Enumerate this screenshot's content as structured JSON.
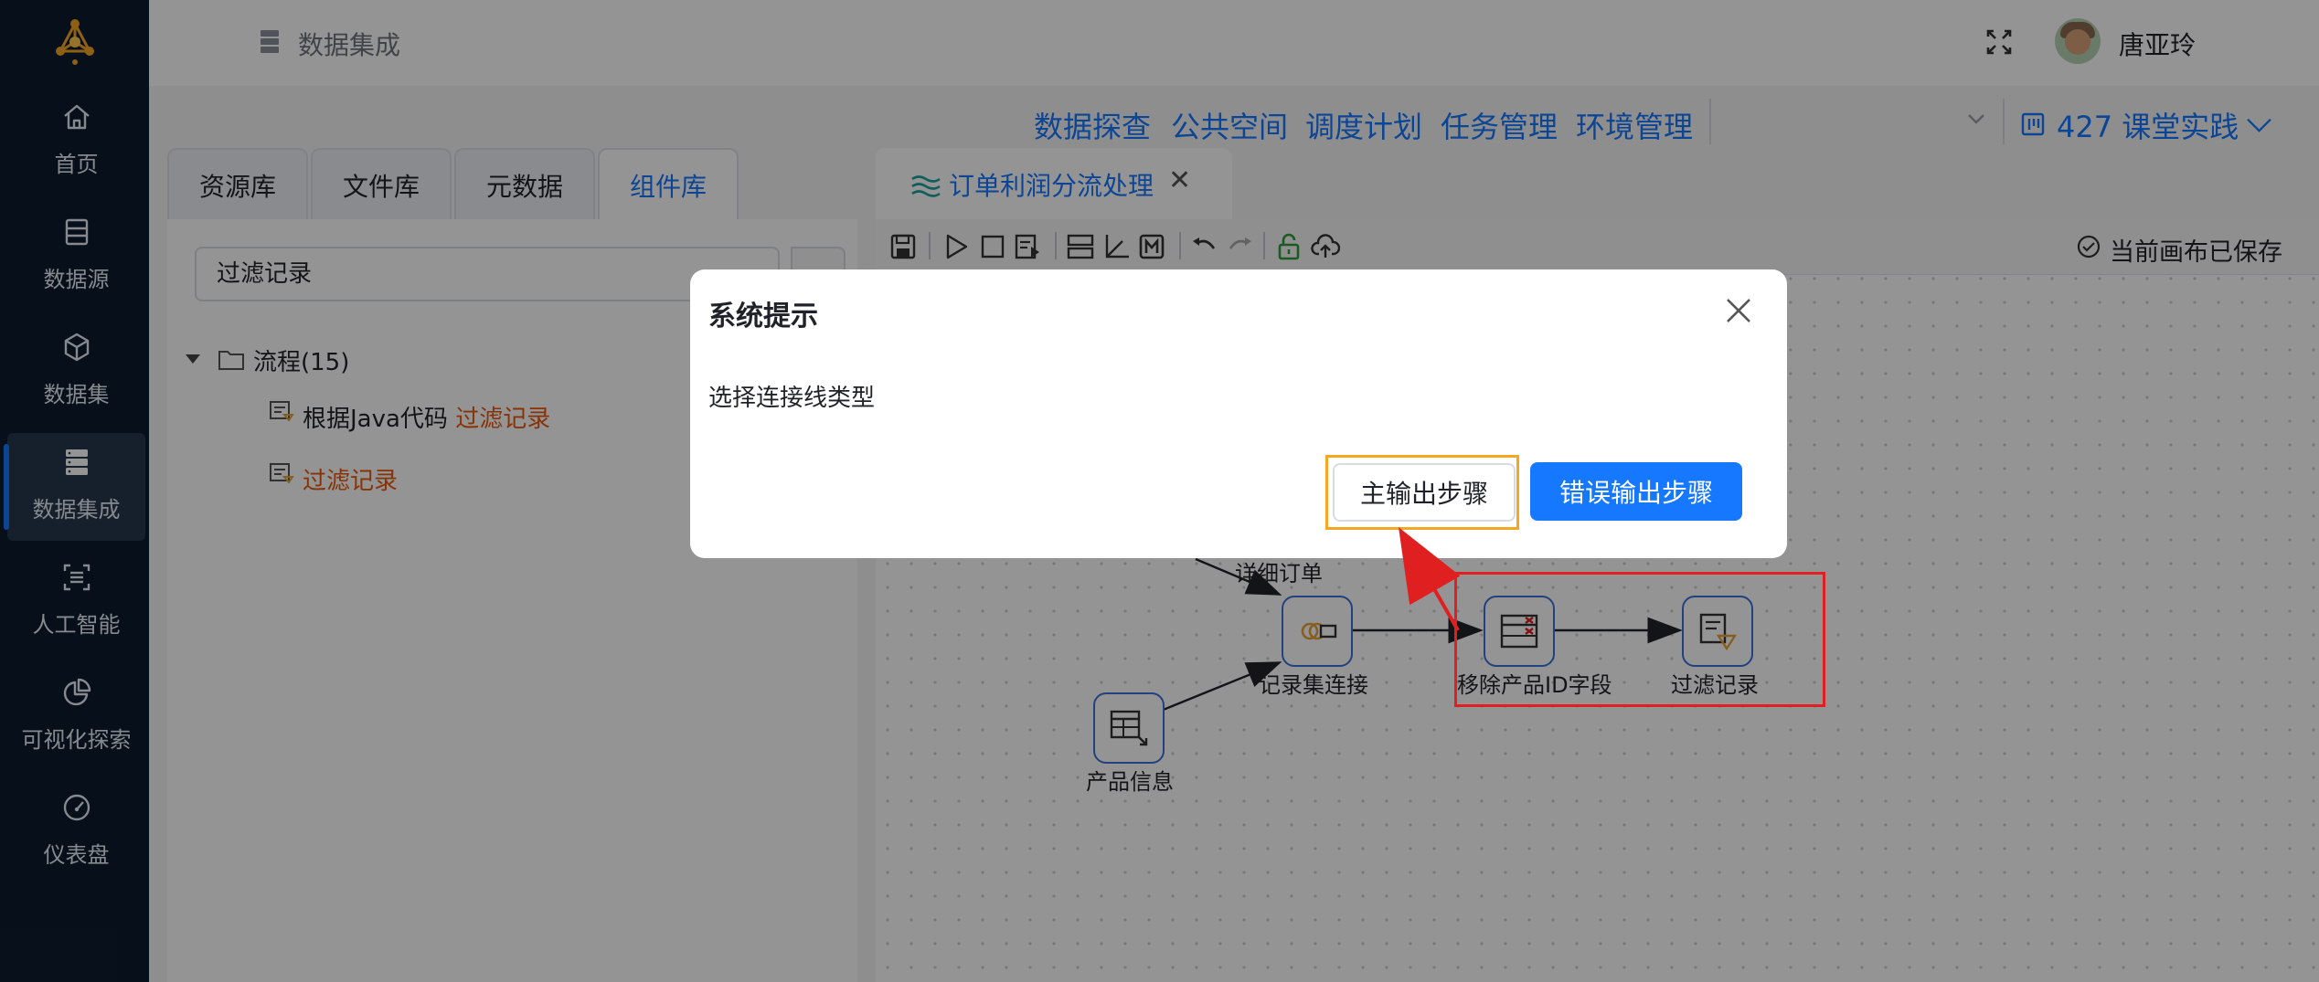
{
  "sidebar": {
    "items": [
      {
        "label": "首页",
        "icon": "home-icon"
      },
      {
        "label": "数据源",
        "icon": "database-icon"
      },
      {
        "label": "数据集",
        "icon": "cube-icon"
      },
      {
        "label": "数据集成",
        "icon": "server-icon",
        "active": true
      },
      {
        "label": "人工智能",
        "icon": "ai-scan-icon"
      },
      {
        "label": "可视化探索",
        "icon": "pie-chart-icon"
      },
      {
        "label": "仪表盘",
        "icon": "gauge-icon"
      }
    ]
  },
  "header": {
    "breadcrumb": "数据集成",
    "user_name": "唐亚玲"
  },
  "top_nav": {
    "links": [
      "数据探查",
      "公共空间",
      "调度计划",
      "任务管理",
      "环境管理"
    ],
    "project": "427 课堂实践"
  },
  "library": {
    "tabs": [
      "资源库",
      "文件库",
      "元数据",
      "组件库"
    ],
    "active_tab": "组件库",
    "search_value": "过滤记录",
    "tree_root": "流程(15)",
    "items": [
      {
        "prefix": "根据Java代码 ",
        "highlight": "过滤记录"
      },
      {
        "prefix": "",
        "highlight": "过滤记录"
      }
    ]
  },
  "canvas": {
    "tab_label": "订单利润分流处理",
    "saved_status": "当前画布已保存",
    "nodes": [
      {
        "id": "detail-order",
        "label": "详细订单"
      },
      {
        "id": "record-join",
        "label": "记录集连接"
      },
      {
        "id": "product-info",
        "label": "产品信息"
      },
      {
        "id": "remove-field",
        "label": "移除产品ID字段"
      },
      {
        "id": "filter-record",
        "label": "过滤记录"
      }
    ]
  },
  "dialog": {
    "title": "系统提示",
    "message": "选择连接线类型",
    "buttons": {
      "main_output": "主输出步骤",
      "error_output": "错误输出步骤"
    }
  },
  "colors": {
    "sidebar_bg": "#0d1b2e",
    "accent": "#1677ff",
    "highlight": "#e8590c",
    "annotation_orange": "#f5a623",
    "annotation_red": "#e02020"
  }
}
